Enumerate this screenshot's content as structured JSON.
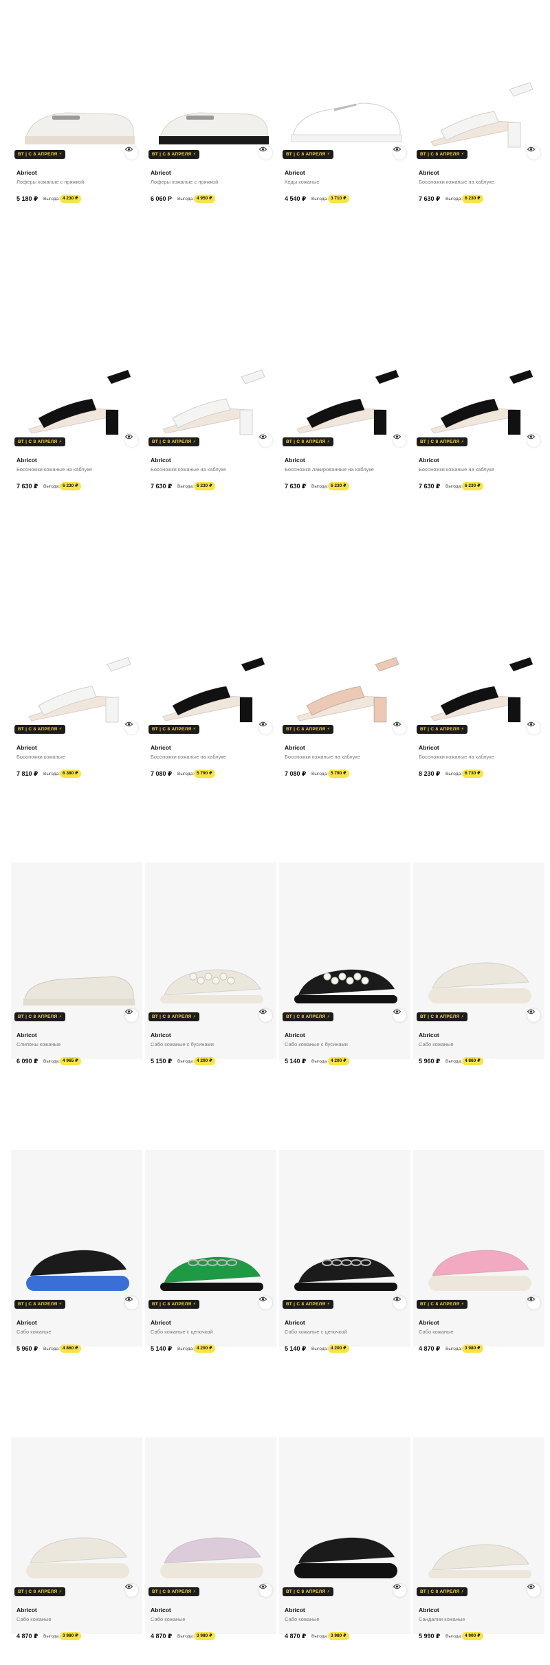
{
  "promo_label": "ВТ | С 8 АПРЕЛЯ ⚡",
  "saving_label": "Выгода:",
  "colors": {
    "promo_bg": "#1c1c1c",
    "promo_text": "#f7d23a",
    "saving_badge": "#f8e542"
  },
  "products": [
    {
      "brand": "Abricot",
      "name": "Лоферы кожаные с пряжкой",
      "price": "5 180 ₽",
      "saving": "4 230 ₽",
      "icon": "white-loafer-icon"
    },
    {
      "brand": "Abricot",
      "name": "Лоферы кожаные с пряжкой",
      "price": "6 060 P",
      "saving": "4 950 ₽",
      "icon": "white-loafer-black-sole-icon"
    },
    {
      "brand": "Abricot",
      "name": "Кеды кожаные",
      "price": "4 540 ₽",
      "saving": "3 710 ₽",
      "icon": "white-sneaker-icon"
    },
    {
      "brand": "Abricot",
      "name": "Босоножки кожаные на каблуке",
      "price": "7 630 ₽",
      "saving": "6 230 ₽",
      "icon": "white-heel-sandal-icon"
    },
    {
      "brand": "Abricot",
      "name": "Босоножки кожаные на каблуке",
      "price": "7 630 ₽",
      "saving": "6 230 ₽",
      "icon": "black-heel-sandal-icon"
    },
    {
      "brand": "Abricot",
      "name": "Босоножки кожаные на каблуке",
      "price": "7 630 ₽",
      "saving": "6 230 ₽",
      "icon": "white-heel-sandal-icon"
    },
    {
      "brand": "Abricot",
      "name": "Босоножки лакированные на каблуке",
      "price": "7 630 ₽",
      "saving": "6 230 ₽",
      "icon": "black-patent-heel-sandal-icon"
    },
    {
      "brand": "Abricot",
      "name": "Босоножки кожаные на каблуке",
      "price": "7 630 ₽",
      "saving": "6 230 ₽",
      "icon": "black-heel-sandal-icon"
    },
    {
      "brand": "Abricot",
      "name": "Босоножки кожаные",
      "price": "7 810 ₽",
      "saving": "6 380 ₽",
      "icon": "white-ankle-strap-sandal-icon"
    },
    {
      "brand": "Abricot",
      "name": "Босоножки кожаные на каблуке",
      "price": "7 080 ₽",
      "saving": "5 790 ₽",
      "icon": "black-ankle-strap-sandal-icon"
    },
    {
      "brand": "Abricot",
      "name": "Босоножки кожаные на каблуке",
      "price": "7 080 ₽",
      "saving": "5 790 ₽",
      "icon": "beige-ankle-strap-sandal-icon"
    },
    {
      "brand": "Abricot",
      "name": "Босоножки кожаные на каблуке",
      "price": "8 230 ₽",
      "saving": "6 730 ₽",
      "icon": "black-block-heel-sandal-icon"
    },
    {
      "brand": "Abricot",
      "name": "Слипоны кожаные",
      "price": "6 090 ₽",
      "saving": "4 965 ₽",
      "icon": "beige-slip-on-icon"
    },
    {
      "brand": "Abricot",
      "name": "Сабо кожаные с бусинами",
      "price": "5 150 ₽",
      "saving": "4 200 ₽",
      "icon": "beige-pearl-slide-icon"
    },
    {
      "brand": "Abricot",
      "name": "Сабо кожаные с бусинами",
      "price": "5 140 ₽",
      "saving": "4 200 ₽",
      "icon": "black-pearl-slide-icon"
    },
    {
      "brand": "Abricot",
      "name": "Сабо кожаные",
      "price": "5 960 ₽",
      "saving": "4 860 ₽",
      "icon": "beige-platform-slide-icon"
    },
    {
      "brand": "Abricot",
      "name": "Сабо кожаные",
      "price": "5 960 ₽",
      "saving": "4 860 ₽",
      "icon": "black-platform-slide-blue-sole-icon"
    },
    {
      "brand": "Abricot",
      "name": "Сабо кожаные с цепочкой",
      "price": "5 140 ₽",
      "saving": "4 200 ₽",
      "icon": "green-chain-slide-icon"
    },
    {
      "brand": "Abricot",
      "name": "Сабо кожаные с цепочкой",
      "price": "5 140 ₽",
      "saving": "4 200 ₽",
      "icon": "black-chain-slide-icon"
    },
    {
      "brand": "Abricot",
      "name": "Сабо кожаные",
      "price": "4 870 ₽",
      "saving": "3 980 ₽",
      "icon": "pink-platform-slide-icon"
    },
    {
      "brand": "Abricot",
      "name": "Сабо кожаные",
      "price": "4 870 ₽",
      "saving": "3 980 ₽",
      "icon": "beige-platform-slide-icon"
    },
    {
      "brand": "Abricot",
      "name": "Сабо кожаные",
      "price": "4 870 ₽",
      "saving": "3 980 ₽",
      "icon": "lilac-platform-slide-icon"
    },
    {
      "brand": "Abricot",
      "name": "Сабо кожаные",
      "price": "4 870 ₽",
      "saving": "3 980 ₽",
      "icon": "black-platform-slide-icon"
    },
    {
      "brand": "Abricot",
      "name": "Сандалии кожаные",
      "price": "5 990 ₽",
      "saving": "4 900 ₽",
      "icon": "beige-strap-sandal-icon"
    }
  ]
}
